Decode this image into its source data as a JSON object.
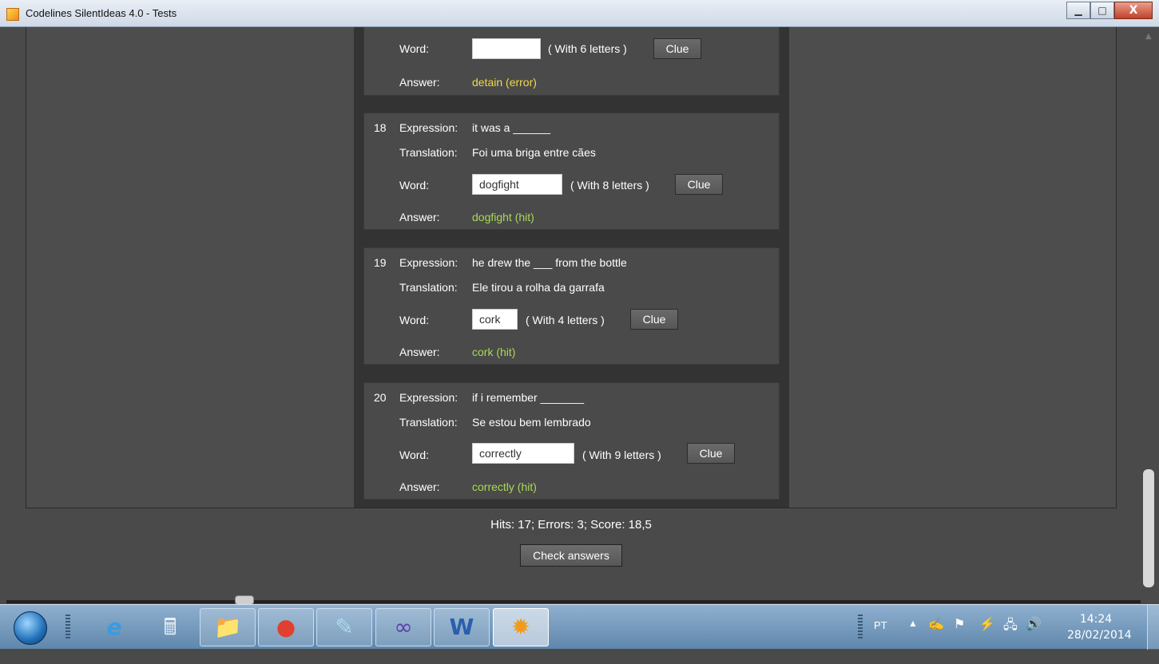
{
  "window": {
    "title": "Codelines SilentIdeas 4.0 - Tests",
    "minimize_icon": "minimize-icon",
    "maximize_icon": "maximize-icon",
    "close_glyph": "X"
  },
  "partial_card": {
    "word_label": "Word:",
    "word_value": "",
    "hint": "( With 6 letters )",
    "clue_label": "Clue",
    "answer_label": "Answer:",
    "answer_value": "detain (error)"
  },
  "cards": [
    {
      "number": "18",
      "expression_label": "Expression:",
      "expression": "it was a ______",
      "translation_label": "Translation:",
      "translation": "Foi uma briga entre cães",
      "word_label": "Word:",
      "word_value": "dogfight",
      "hint": "( With 8 letters )",
      "clue_label": "Clue",
      "answer_label": "Answer:",
      "answer_value": "dogfight (hit)"
    },
    {
      "number": "19",
      "expression_label": "Expression:",
      "expression": "he drew the ___ from the bottle",
      "translation_label": "Translation:",
      "translation": "Ele tirou a rolha da garrafa",
      "word_label": "Word:",
      "word_value": "cork",
      "hint": "( With 4 letters )",
      "clue_label": "Clue",
      "answer_label": "Answer:",
      "answer_value": "cork (hit)"
    },
    {
      "number": "20",
      "expression_label": "Expression:",
      "expression": "if i remember _______",
      "translation_label": "Translation:",
      "translation": "Se estou bem lembrado",
      "word_label": "Word:",
      "word_value": "correctly",
      "hint": "( With 9 letters )",
      "clue_label": "Clue",
      "answer_label": "Answer:",
      "answer_value": "correctly (hit)"
    }
  ],
  "results": {
    "stats": "Hits: 17; Errors: 3; Score: 18,5",
    "check_button": "Check answers"
  },
  "taskbar": {
    "items": [
      "windows-start-icon",
      "internet-explorer-icon",
      "calculator-icon",
      "file-explorer-icon",
      "chrome-icon",
      "notepad-icon",
      "visual-studio-icon",
      "word-icon",
      "silentideas-icon"
    ],
    "language": "PT",
    "time": "14:24",
    "date": "28/02/2014"
  },
  "colors": {
    "hit": "#a9d957",
    "error": "#f0d84a"
  }
}
